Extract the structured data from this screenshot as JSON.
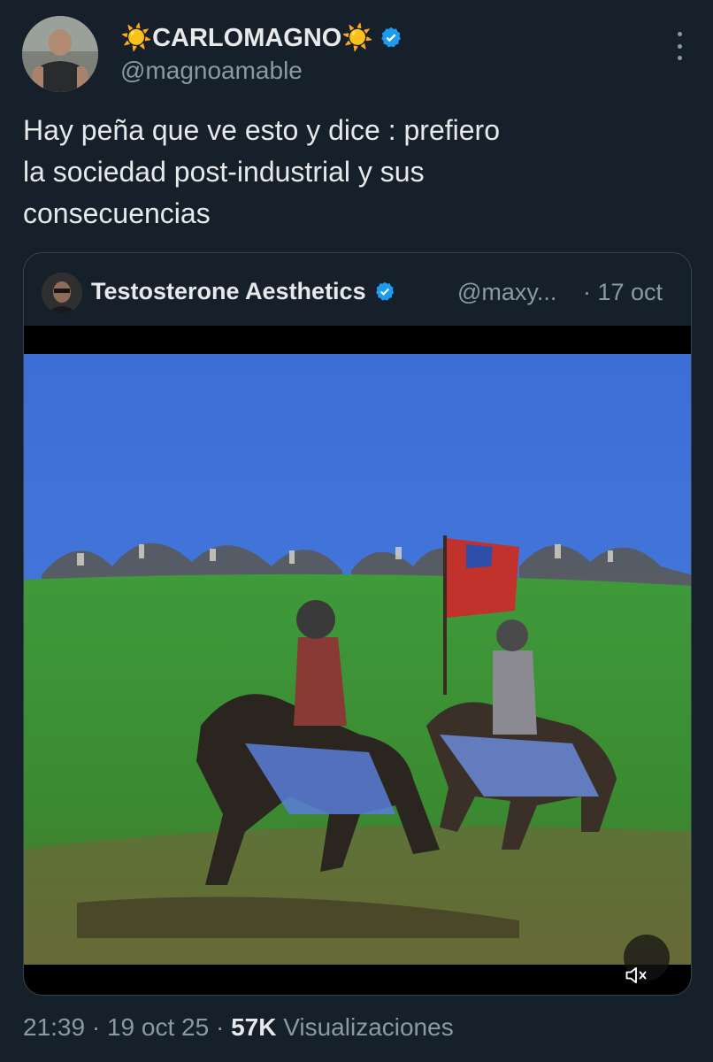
{
  "author": {
    "display_name": "☀️CARLOMAGNO☀️",
    "handle": "@magnoamable",
    "verified": true,
    "verified_color": "#1d9bf0"
  },
  "tweet": {
    "text_lines": [
      "Hay peña que ve esto y dice : prefiero",
      "la sociedad post-industrial y sus",
      "consecuencias"
    ]
  },
  "quoted": {
    "display_name": "Testosterone Aesthetics",
    "handle": "@maxy...",
    "date": "· 17 oct",
    "verified": true,
    "media": {
      "type": "video",
      "muted": true,
      "icon": "speaker-muted-icon"
    }
  },
  "meta": {
    "time": "21:39",
    "sep1": "·",
    "date": "19 oct 25",
    "sep2": "·",
    "views_count": "57K",
    "views_label": "Visualizaciones"
  },
  "colors": {
    "background": "#15202b",
    "text_primary": "#e7e9ea",
    "text_secondary": "#8b98a5",
    "border": "#38444d",
    "accent": "#1d9bf0"
  }
}
